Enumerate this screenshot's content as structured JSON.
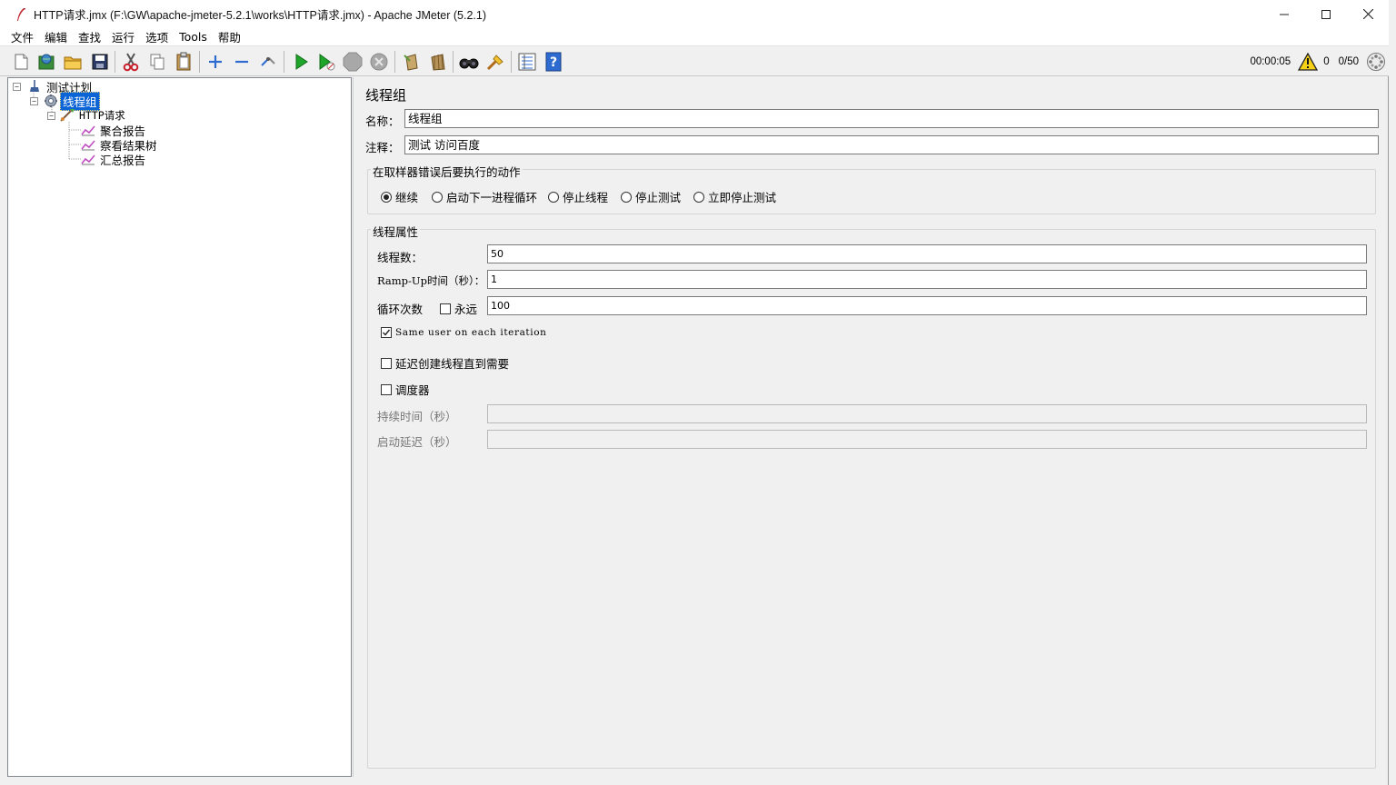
{
  "window": {
    "title": "HTTP请求.jmx (F:\\GW\\apache-jmeter-5.2.1\\works\\HTTP请求.jmx) - Apache JMeter (5.2.1)",
    "controls": {
      "minimize": "—",
      "maximize": "☐",
      "close": "✕"
    }
  },
  "menu": {
    "items": [
      "文件",
      "编辑",
      "查找",
      "运行",
      "选项",
      "Tools",
      "帮助"
    ]
  },
  "toolbar": {
    "buttons": [
      {
        "icon": "new-file-icon"
      },
      {
        "icon": "templates-icon"
      },
      {
        "icon": "open-folder-icon"
      },
      {
        "icon": "save-icon"
      },
      {
        "icon": "cut-icon"
      },
      {
        "icon": "copy-icon"
      },
      {
        "icon": "paste-icon"
      },
      {
        "icon": "expand-icon"
      },
      {
        "icon": "collapse-icon"
      },
      {
        "icon": "toggle-icon"
      },
      {
        "icon": "start-icon"
      },
      {
        "icon": "start-no-pause-icon"
      },
      {
        "icon": "stop-icon"
      },
      {
        "icon": "shutdown-icon"
      },
      {
        "icon": "clear-icon"
      },
      {
        "icon": "clear-all-icon"
      },
      {
        "icon": "search-icon"
      },
      {
        "icon": "reset-search-icon"
      },
      {
        "icon": "function-helper-icon"
      },
      {
        "icon": "help-icon"
      }
    ],
    "status": {
      "elapsed": "00:00:05",
      "warnings": "0",
      "threads": "0/50"
    }
  },
  "tree": {
    "nodes": [
      {
        "label": "测试计划",
        "icon": "test-plan-icon"
      },
      {
        "label": "线程组",
        "icon": "thread-group-icon"
      },
      {
        "label": "HTTP请求",
        "icon": "http-sampler-icon"
      },
      {
        "label": "聚合报告",
        "icon": "listener-icon"
      },
      {
        "label": "察看结果树",
        "icon": "listener-icon"
      },
      {
        "label": "汇总报告",
        "icon": "listener-icon"
      }
    ]
  },
  "panel": {
    "title": "线程组",
    "name_label": "名称：",
    "name_value": "线程组",
    "comment_label": "注释：",
    "comment_value": "测试 访问百度",
    "error_action": {
      "title": "在取样器错误后要执行的动作",
      "options": [
        "继续",
        "启动下一进程循环",
        "停止线程",
        "停止测试",
        "立即停止测试"
      ],
      "selected": "继续"
    },
    "thread_props": {
      "title": "线程属性",
      "threads_label": "线程数：",
      "threads_value": "50",
      "rampup_label": "Ramp-Up时间（秒）：",
      "rampup_value": "1",
      "loop_label": "循环次数",
      "forever_label": "永远",
      "forever_checked": false,
      "loop_value": "100",
      "same_user_label": "Same user on each iteration",
      "same_user_checked": true,
      "delay_label": "延迟创建线程直到需要",
      "delay_checked": false,
      "scheduler_label": "调度器",
      "scheduler_checked": false,
      "duration_label": "持续时间（秒）",
      "duration_value": "",
      "startup_delay_label": "启动延迟（秒）",
      "startup_delay_value": ""
    }
  },
  "colors": {
    "selection": "#0a64d6",
    "play_green": "#1fa52a",
    "plus_blue": "#2e6bd1"
  }
}
